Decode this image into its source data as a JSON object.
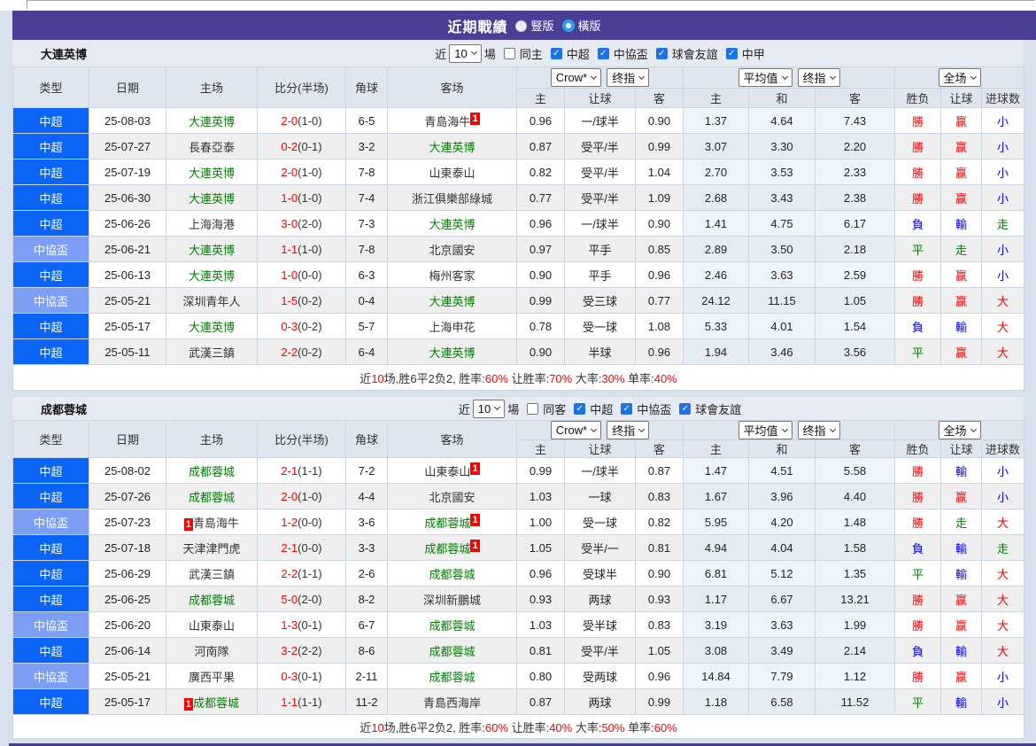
{
  "page": {
    "title": "近期戰績",
    "layout_options": [
      {
        "label": "豎版",
        "selected": false
      },
      {
        "label": "橫版",
        "selected": true
      }
    ]
  },
  "colors": {
    "title_bg": "#4a3f94",
    "league": {
      "中超": "#0a64f5",
      "中協盃": "#7d9ef5"
    },
    "team_focus": "#008000",
    "team_normal": "#333333",
    "score": "#fe0000",
    "result": {
      "勝": "#fe0000",
      "負": "#0000fe",
      "平": "#008000",
      "赢": "#fe0000",
      "輸": "#0000fe",
      "走": "#008000",
      "大": "#fe0000",
      "小": "#0000fe"
    }
  },
  "table": {
    "columns": [
      "类型",
      "日期",
      "主场",
      "比分(半场)",
      "角球",
      "客场",
      "主",
      "让球",
      "客",
      "主",
      "和",
      "客",
      "胜负",
      "让球",
      "进球数"
    ],
    "group_selects": {
      "group1": [
        "Crow*",
        "终指"
      ],
      "group2": [
        "平均值",
        "终指"
      ],
      "group3": [
        "全场"
      ]
    }
  },
  "sections": [
    {
      "team": "大連英博",
      "filter": {
        "near_label": "近",
        "games_value": "10",
        "games_suffix": "場",
        "same_label": "同主",
        "same_checked": false,
        "leagues": [
          {
            "label": "中超",
            "checked": true
          },
          {
            "label": "中協盃",
            "checked": true
          },
          {
            "label": "球會友誼",
            "checked": true
          },
          {
            "label": "中甲",
            "checked": true
          }
        ]
      },
      "rows": [
        {
          "league": "中超",
          "date": "25-08-03",
          "home": "大連英博",
          "home_focus": true,
          "home_badge": null,
          "score": "2-0",
          "half": "(1-0)",
          "corner": "6-5",
          "away": "青島海牛",
          "away_focus": false,
          "away_badge": "after",
          "odds": [
            "0.96",
            "一/球半",
            "0.90"
          ],
          "avg": [
            "1.37",
            "4.64",
            "7.43"
          ],
          "result": [
            "勝",
            "赢",
            "小"
          ]
        },
        {
          "league": "中超",
          "date": "25-07-27",
          "home": "長春亞泰",
          "home_focus": false,
          "home_badge": null,
          "score": "0-2",
          "half": "(0-1)",
          "corner": "3-2",
          "away": "大連英博",
          "away_focus": true,
          "away_badge": null,
          "odds": [
            "0.87",
            "受平/半",
            "0.99"
          ],
          "avg": [
            "3.07",
            "3.30",
            "2.20"
          ],
          "result": [
            "勝",
            "赢",
            "小"
          ]
        },
        {
          "league": "中超",
          "date": "25-07-19",
          "home": "大連英博",
          "home_focus": true,
          "home_badge": null,
          "score": "2-0",
          "half": "(1-0)",
          "corner": "7-8",
          "away": "山東泰山",
          "away_focus": false,
          "away_badge": null,
          "odds": [
            "0.82",
            "受平/半",
            "1.04"
          ],
          "avg": [
            "2.70",
            "3.53",
            "2.33"
          ],
          "result": [
            "勝",
            "赢",
            "小"
          ]
        },
        {
          "league": "中超",
          "date": "25-06-30",
          "home": "大連英博",
          "home_focus": true,
          "home_badge": null,
          "score": "1-0",
          "half": "(1-0)",
          "corner": "7-4",
          "away": "浙江俱樂部綠城",
          "away_focus": false,
          "away_badge": null,
          "odds": [
            "0.77",
            "受平/半",
            "1.09"
          ],
          "avg": [
            "2.68",
            "3.43",
            "2.38"
          ],
          "result": [
            "勝",
            "赢",
            "小"
          ]
        },
        {
          "league": "中超",
          "date": "25-06-26",
          "home": "上海海港",
          "home_focus": false,
          "home_badge": null,
          "score": "3-0",
          "half": "(2-0)",
          "corner": "7-3",
          "away": "大連英博",
          "away_focus": true,
          "away_badge": null,
          "odds": [
            "0.96",
            "一/球半",
            "0.90"
          ],
          "avg": [
            "1.41",
            "4.75",
            "6.17"
          ],
          "result": [
            "負",
            "輸",
            "走"
          ]
        },
        {
          "league": "中協盃",
          "date": "25-06-21",
          "home": "大連英博",
          "home_focus": true,
          "home_badge": null,
          "score": "1-1",
          "half": "(1-0)",
          "corner": "7-8",
          "away": "北京國安",
          "away_focus": false,
          "away_badge": null,
          "odds": [
            "0.97",
            "平手",
            "0.85"
          ],
          "avg": [
            "2.89",
            "3.50",
            "2.18"
          ],
          "result": [
            "平",
            "走",
            "小"
          ]
        },
        {
          "league": "中超",
          "date": "25-06-13",
          "home": "大連英博",
          "home_focus": true,
          "home_badge": null,
          "score": "1-0",
          "half": "(0-0)",
          "corner": "6-3",
          "away": "梅州客家",
          "away_focus": false,
          "away_badge": null,
          "odds": [
            "0.90",
            "平手",
            "0.96"
          ],
          "avg": [
            "2.46",
            "3.63",
            "2.59"
          ],
          "result": [
            "勝",
            "赢",
            "小"
          ]
        },
        {
          "league": "中協盃",
          "date": "25-05-21",
          "home": "深圳青年人",
          "home_focus": false,
          "home_badge": null,
          "score": "1-5",
          "half": "(0-2)",
          "corner": "0-4",
          "away": "大連英博",
          "away_focus": true,
          "away_badge": null,
          "odds": [
            "0.99",
            "受三球",
            "0.77"
          ],
          "avg": [
            "24.12",
            "11.15",
            "1.05"
          ],
          "result": [
            "勝",
            "赢",
            "大"
          ]
        },
        {
          "league": "中超",
          "date": "25-05-17",
          "home": "大連英博",
          "home_focus": true,
          "home_badge": null,
          "score": "0-3",
          "half": "(0-2)",
          "corner": "5-7",
          "away": "上海申花",
          "away_focus": false,
          "away_badge": null,
          "odds": [
            "0.78",
            "受一球",
            "1.08"
          ],
          "avg": [
            "5.33",
            "4.01",
            "1.54"
          ],
          "result": [
            "負",
            "輸",
            "大"
          ]
        },
        {
          "league": "中超",
          "date": "25-05-11",
          "home": "武漢三鎮",
          "home_focus": false,
          "home_badge": null,
          "score": "2-2",
          "half": "(0-2)",
          "corner": "6-4",
          "away": "大連英博",
          "away_focus": true,
          "away_badge": null,
          "odds": [
            "0.90",
            "半球",
            "0.96"
          ],
          "avg": [
            "1.94",
            "3.46",
            "3.56"
          ],
          "result": [
            "平",
            "赢",
            "大"
          ]
        }
      ],
      "summary_segments": [
        {
          "text": "近",
          "red": false
        },
        {
          "text": "10",
          "red": true
        },
        {
          "text": "场,胜6平2负2, 胜率:",
          "red": false
        },
        {
          "text": "60%",
          "red": true
        },
        {
          "text": " 让胜率:",
          "red": false
        },
        {
          "text": "70%",
          "red": true
        },
        {
          "text": " 大率:",
          "red": false
        },
        {
          "text": "30%",
          "red": true
        },
        {
          "text": " 单率:",
          "red": false
        },
        {
          "text": "40%",
          "red": true
        }
      ]
    },
    {
      "team": "成都蓉城",
      "filter": {
        "near_label": "近",
        "games_value": "10",
        "games_suffix": "場",
        "same_label": "同客",
        "same_checked": false,
        "leagues": [
          {
            "label": "中超",
            "checked": true
          },
          {
            "label": "中協盃",
            "checked": true
          },
          {
            "label": "球會友誼",
            "checked": true
          }
        ]
      },
      "rows": [
        {
          "league": "中超",
          "date": "25-08-02",
          "home": "成都蓉城",
          "home_focus": true,
          "home_badge": null,
          "score": "2-1",
          "half": "(1-1)",
          "corner": "7-2",
          "away": "山東泰山",
          "away_focus": false,
          "away_badge": "after",
          "odds": [
            "0.99",
            "一/球半",
            "0.87"
          ],
          "avg": [
            "1.47",
            "4.51",
            "5.58"
          ],
          "result": [
            "勝",
            "輸",
            "小"
          ]
        },
        {
          "league": "中超",
          "date": "25-07-26",
          "home": "成都蓉城",
          "home_focus": true,
          "home_badge": null,
          "score": "2-0",
          "half": "(1-0)",
          "corner": "4-4",
          "away": "北京國安",
          "away_focus": false,
          "away_badge": null,
          "odds": [
            "1.03",
            "一球",
            "0.83"
          ],
          "avg": [
            "1.67",
            "3.96",
            "4.40"
          ],
          "result": [
            "勝",
            "赢",
            "小"
          ]
        },
        {
          "league": "中協盃",
          "date": "25-07-23",
          "home": "青島海牛",
          "home_focus": false,
          "home_badge": "before",
          "score": "1-2",
          "half": "(0-0)",
          "corner": "3-6",
          "away": "成都蓉城",
          "away_focus": true,
          "away_badge": "after",
          "odds": [
            "1.00",
            "受一球",
            "0.82"
          ],
          "avg": [
            "5.95",
            "4.20",
            "1.48"
          ],
          "result": [
            "勝",
            "走",
            "大"
          ]
        },
        {
          "league": "中超",
          "date": "25-07-18",
          "home": "天津津門虎",
          "home_focus": false,
          "home_badge": null,
          "score": "2-1",
          "half": "(0-0)",
          "corner": "3-3",
          "away": "成都蓉城",
          "away_focus": true,
          "away_badge": "after",
          "odds": [
            "1.05",
            "受半/一",
            "0.81"
          ],
          "avg": [
            "4.94",
            "4.04",
            "1.58"
          ],
          "result": [
            "負",
            "輸",
            "走"
          ]
        },
        {
          "league": "中超",
          "date": "25-06-29",
          "home": "武漢三鎮",
          "home_focus": false,
          "home_badge": null,
          "score": "2-2",
          "half": "(1-1)",
          "corner": "2-6",
          "away": "成都蓉城",
          "away_focus": true,
          "away_badge": null,
          "odds": [
            "0.96",
            "受球半",
            "0.90"
          ],
          "avg": [
            "6.81",
            "5.12",
            "1.35"
          ],
          "result": [
            "平",
            "輸",
            "大"
          ]
        },
        {
          "league": "中超",
          "date": "25-06-25",
          "home": "成都蓉城",
          "home_focus": true,
          "home_badge": null,
          "score": "5-0",
          "half": "(2-0)",
          "corner": "8-2",
          "away": "深圳新鵬城",
          "away_focus": false,
          "away_badge": null,
          "odds": [
            "0.93",
            "两球",
            "0.93"
          ],
          "avg": [
            "1.17",
            "6.67",
            "13.21"
          ],
          "result": [
            "勝",
            "赢",
            "大"
          ]
        },
        {
          "league": "中協盃",
          "date": "25-06-20",
          "home": "山東泰山",
          "home_focus": false,
          "home_badge": null,
          "score": "1-3",
          "half": "(0-1)",
          "corner": "6-7",
          "away": "成都蓉城",
          "away_focus": true,
          "away_badge": null,
          "odds": [
            "1.03",
            "受半球",
            "0.83"
          ],
          "avg": [
            "3.19",
            "3.63",
            "1.99"
          ],
          "result": [
            "勝",
            "赢",
            "大"
          ]
        },
        {
          "league": "中超",
          "date": "25-06-14",
          "home": "河南隊",
          "home_focus": false,
          "home_badge": null,
          "score": "3-2",
          "half": "(2-2)",
          "corner": "8-6",
          "away": "成都蓉城",
          "away_focus": true,
          "away_badge": null,
          "odds": [
            "0.81",
            "受平/半",
            "1.05"
          ],
          "avg": [
            "3.08",
            "3.49",
            "2.14"
          ],
          "result": [
            "負",
            "輸",
            "大"
          ]
        },
        {
          "league": "中協盃",
          "date": "25-05-21",
          "home": "廣西平果",
          "home_focus": false,
          "home_badge": null,
          "score": "0-3",
          "half": "(0-1)",
          "corner": "2-11",
          "away": "成都蓉城",
          "away_focus": true,
          "away_badge": null,
          "odds": [
            "0.80",
            "受两球",
            "0.96"
          ],
          "avg": [
            "14.84",
            "7.79",
            "1.12"
          ],
          "result": [
            "勝",
            "赢",
            "小"
          ]
        },
        {
          "league": "中超",
          "date": "25-05-17",
          "home": "成都蓉城",
          "home_focus": true,
          "home_badge": "before",
          "score": "1-1",
          "half": "(1-1)",
          "corner": "11-2",
          "away": "青島西海岸",
          "away_focus": false,
          "away_badge": null,
          "odds": [
            "0.87",
            "两球",
            "0.99"
          ],
          "avg": [
            "1.18",
            "6.58",
            "11.52"
          ],
          "result": [
            "平",
            "輸",
            "小"
          ]
        }
      ],
      "summary_segments": [
        {
          "text": "近",
          "red": false
        },
        {
          "text": "10",
          "red": true
        },
        {
          "text": "场,胜6平2负2, 胜率:",
          "red": false
        },
        {
          "text": "60%",
          "red": true
        },
        {
          "text": " 让胜率:",
          "red": false
        },
        {
          "text": "40%",
          "red": true
        },
        {
          "text": " 大率:",
          "red": false
        },
        {
          "text": "50%",
          "red": true
        },
        {
          "text": " 单率:",
          "red": false
        },
        {
          "text": "60%",
          "red": true
        }
      ]
    }
  ]
}
